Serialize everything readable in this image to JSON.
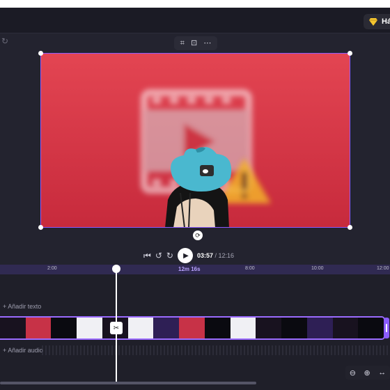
{
  "header": {
    "upgrade_label": "Há"
  },
  "preview": {
    "toolbar_icons": [
      "crop-icon",
      "fit-icon",
      "more-options-icon"
    ]
  },
  "player": {
    "current_time": "03:57",
    "separator": " / ",
    "total_time": "12:16"
  },
  "ruler": {
    "ticks": [
      "2:00",
      "12m 16s",
      "8:00",
      "10:00",
      "12:00"
    ]
  },
  "tracks": {
    "add_text_label": "+ Añadir texto",
    "add_audio_label": "+ Añadir audio"
  }
}
